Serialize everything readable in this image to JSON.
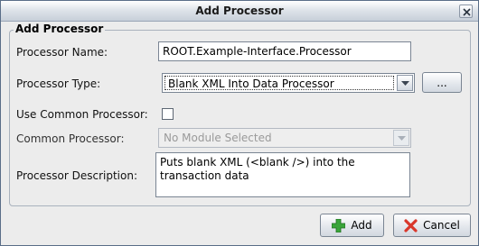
{
  "window": {
    "title": "Add Processor"
  },
  "form": {
    "group_title": "Add Processor",
    "name_label": "Processor Name:",
    "name_value": "ROOT.Example-Interface.Processor",
    "type_label": "Processor Type:",
    "type_value": "Blank XML Into Data Processor",
    "browse_label": "...",
    "use_common_label": "Use Common Processor:",
    "use_common_checked": false,
    "common_label": "Common Processor:",
    "common_value": "No Module Selected",
    "description_label": "Processor Description:",
    "description_value": "Puts blank XML (<blank />) into the transaction data"
  },
  "actions": {
    "add_label": "Add",
    "cancel_label": "Cancel"
  },
  "colors": {
    "add_icon": "#3aa53a",
    "cancel_icon": "#d9372b"
  },
  "icons": {
    "close": "close-icon",
    "add": "plus-icon",
    "cancel": "x-icon"
  }
}
